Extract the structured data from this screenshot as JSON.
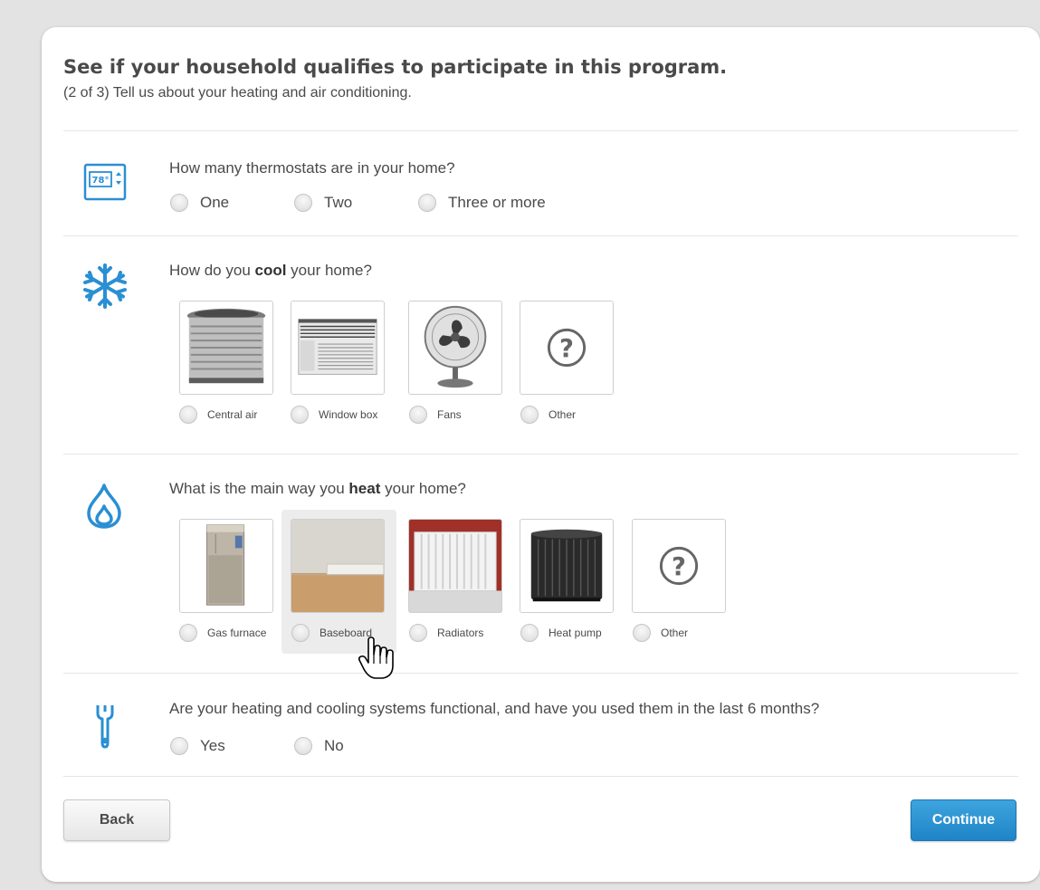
{
  "colors": {
    "accent": "#2a8fd3",
    "button_blue": "#2a8fd3",
    "text": "#4a4a4a"
  },
  "header": {
    "title": "See if your household qualifies to participate in this program.",
    "subtitle": "(2 of 3) Tell us about your heating and air conditioning."
  },
  "thermostats": {
    "icon": "thermostat-icon",
    "icon_text": "78°",
    "question": "How many thermostats are in your home?",
    "options": [
      "One",
      "Two",
      "Three or more"
    ]
  },
  "cooling": {
    "icon": "snowflake-icon",
    "question_pre": "How do you ",
    "question_bold": "cool",
    "question_post": " your home?",
    "options": [
      {
        "label": "Central air",
        "image": "central-air-unit"
      },
      {
        "label": "Window box",
        "image": "window-ac-unit"
      },
      {
        "label": "Fans",
        "image": "desk-fan"
      },
      {
        "label": "Other",
        "image": "question-mark-icon"
      }
    ]
  },
  "heating": {
    "icon": "flame-drop-icon",
    "question_pre": "What is the main way you ",
    "question_bold": "heat",
    "question_post": " your home?",
    "options": [
      {
        "label": "Gas furnace",
        "image": "gas-furnace"
      },
      {
        "label": "Baseboard",
        "image": "baseboard-heater"
      },
      {
        "label": "Radiators",
        "image": "radiator"
      },
      {
        "label": "Heat pump",
        "image": "heat-pump"
      },
      {
        "label": "Other",
        "image": "question-mark-icon"
      }
    ]
  },
  "functional": {
    "icon": "wrench-icon",
    "question": "Are your heating and cooling systems functional, and have you used them in the last 6 months?",
    "options": [
      "Yes",
      "No"
    ]
  },
  "buttons": {
    "back": "Back",
    "continue": "Continue"
  }
}
